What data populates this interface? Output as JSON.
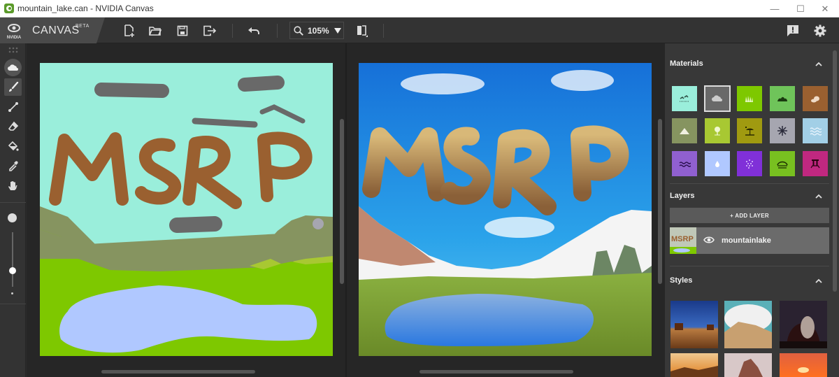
{
  "window": {
    "title": "mountain_lake.can - NVIDIA Canvas",
    "controls": {
      "minimize": "—",
      "maximize": "☐",
      "close": "✕"
    }
  },
  "toolbar": {
    "brand_vendor": "NVIDIA",
    "brand_name": "CANVAS",
    "brand_badge": "BETA",
    "buttons": [
      {
        "name": "new-file",
        "icon": "new-file-icon"
      },
      {
        "name": "open-file",
        "icon": "folder-open-icon"
      },
      {
        "name": "save",
        "icon": "save-icon"
      },
      {
        "name": "export",
        "icon": "export-icon"
      },
      {
        "name": "undo",
        "icon": "undo-icon"
      },
      {
        "name": "toggle-view",
        "icon": "split-view-icon"
      },
      {
        "name": "feedback",
        "icon": "feedback-icon"
      },
      {
        "name": "settings",
        "icon": "gear-icon"
      }
    ],
    "zoom_value": "105%"
  },
  "tools": [
    {
      "name": "material",
      "icon": "cloud-icon",
      "active": false
    },
    {
      "name": "brush",
      "icon": "brush-icon",
      "active": true
    },
    {
      "name": "line",
      "icon": "line-icon",
      "active": false
    },
    {
      "name": "eraser",
      "icon": "eraser-icon",
      "active": false
    },
    {
      "name": "fill",
      "icon": "paint-bucket-icon",
      "active": false
    },
    {
      "name": "eyedropper",
      "icon": "eyedropper-icon",
      "active": false
    },
    {
      "name": "pan",
      "icon": "hand-icon",
      "active": false
    }
  ],
  "brush_size": {
    "value_fraction": 0.3
  },
  "sidebar": {
    "materials": {
      "title": "Materials",
      "items": [
        {
          "name": "sky",
          "color": "#9aeedb",
          "icon": "birds"
        },
        {
          "name": "cloud",
          "color": "#696969",
          "icon": "cloud",
          "selected": true
        },
        {
          "name": "grass",
          "color": "#7ec800",
          "icon": "grass"
        },
        {
          "name": "bush",
          "color": "#6fc45a",
          "icon": "bush"
        },
        {
          "name": "rock",
          "color": "#9a6030",
          "icon": "rocks"
        },
        {
          "name": "mountain",
          "color": "#869460",
          "icon": "mountain"
        },
        {
          "name": "tree",
          "color": "#a8c832",
          "icon": "tree"
        },
        {
          "name": "sand",
          "color": "#a09a10",
          "icon": "beach"
        },
        {
          "name": "snow",
          "color": "#a6a6b0",
          "icon": "snowflake"
        },
        {
          "name": "sea",
          "color": "#a2cfe6",
          "icon": "waves"
        },
        {
          "name": "river",
          "color": "#9060d0",
          "icon": "ripples"
        },
        {
          "name": "water",
          "color": "#b0c8ff",
          "icon": "drop"
        },
        {
          "name": "fog",
          "color": "#8030d8",
          "icon": "dots"
        },
        {
          "name": "hill",
          "color": "#78c020",
          "icon": "hill"
        },
        {
          "name": "stone",
          "color": "#c02880",
          "icon": "pillar"
        }
      ]
    },
    "layers": {
      "title": "Layers",
      "add_label": "+ ADD LAYER",
      "items": [
        {
          "name": "mountainlake",
          "visible": true
        }
      ]
    },
    "styles": {
      "title": "Styles",
      "items": [
        "desert-night",
        "cloud-cliff",
        "arch-milkyway",
        "sunset-mesa",
        "rock-spire",
        "ocean-sunset"
      ]
    }
  },
  "colors": {
    "accent": "#76b900",
    "toolbar_bg": "#333333",
    "panel_bg": "#383838"
  }
}
